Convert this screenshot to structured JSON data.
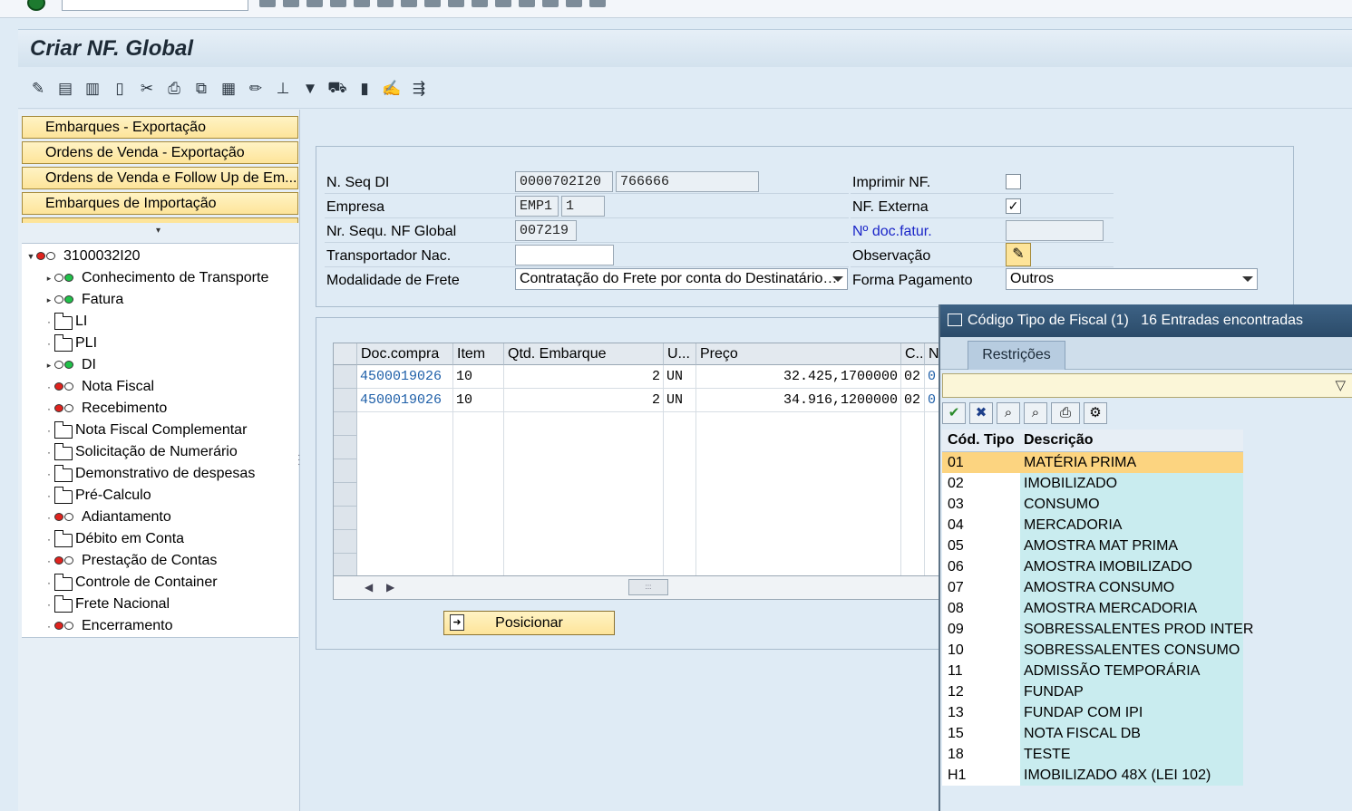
{
  "window": {
    "title": "Criar NF. Global"
  },
  "left": {
    "nav_buttons": [
      "Embarques - Exportação",
      "Ordens de Venda - Exportação",
      "Ordens de Venda e Follow Up de Em...",
      "Embarques de Importação"
    ],
    "tree": {
      "root": "3100032I20",
      "nodes": [
        {
          "label": "Conhecimento de Transporte",
          "icon": "traffic-light-green"
        },
        {
          "label": "Fatura",
          "icon": "traffic-light-green"
        },
        {
          "label": "LI",
          "icon": "folder"
        },
        {
          "label": "PLI",
          "icon": "folder"
        },
        {
          "label": "DI",
          "icon": "traffic-light-green"
        },
        {
          "label": "Nota Fiscal",
          "icon": "traffic-light-red"
        },
        {
          "label": "Recebimento",
          "icon": "traffic-light-red"
        },
        {
          "label": "Nota Fiscal Complementar",
          "icon": "folder"
        },
        {
          "label": "Solicitação de Numerário",
          "icon": "folder"
        },
        {
          "label": "Demonstrativo de despesas",
          "icon": "folder"
        },
        {
          "label": "Pré-Calculo",
          "icon": "folder"
        },
        {
          "label": "Adiantamento",
          "icon": "traffic-light-red"
        },
        {
          "label": "Débito em Conta",
          "icon": "folder"
        },
        {
          "label": "Prestação de Contas",
          "icon": "traffic-light-red"
        },
        {
          "label": "Controle de Container",
          "icon": "folder"
        },
        {
          "label": "Frete Nacional",
          "icon": "folder"
        },
        {
          "label": "Encerramento",
          "icon": "traffic-light-red"
        }
      ]
    }
  },
  "header": {
    "nseq_label": "N. Seq DI",
    "nseq_value1": "0000702I20",
    "nseq_value2": "766666",
    "empresa_label": "Empresa",
    "empresa_value1": "EMP1",
    "empresa_value2": "1",
    "nrseq_label": "Nr. Sequ. NF Global",
    "nrseq_value": "007219",
    "transp_label": "Transportador Nac.",
    "transp_value": "",
    "modal_label": "Modalidade de Frete",
    "modal_value": "Contratação do Frete por conta do Destinatário…",
    "imprimir_label": "Imprimir NF.",
    "imprimir_checked": false,
    "nfext_label": "NF. Externa",
    "nfext_checked": true,
    "nfext_mark": "✓",
    "docfatur_label": "Nº doc.fatur.",
    "docfatur_value": "",
    "obs_label": "Observação",
    "forma_label": "Forma Pagamento",
    "forma_value": "Outros"
  },
  "grid": {
    "columns": [
      "Doc.compra",
      "Item",
      "Qtd. Embarque",
      "U...",
      "Preço",
      "C..",
      "N"
    ],
    "rows": [
      {
        "doc": "4500019026",
        "item": "10",
        "qtd": "2",
        "un": "UN",
        "preco": "32.425,1700000",
        "c": "02",
        "n": "0"
      },
      {
        "doc": "4500019026",
        "item": "10",
        "qtd": "2",
        "un": "UN",
        "preco": "34.916,1200000",
        "c": "02",
        "n": "0"
      }
    ],
    "position_button": "Posicionar"
  },
  "popup": {
    "title": "Código Tipo de Fiscal (1)",
    "count_text": "16 Entradas encontradas",
    "tab": "Restrições",
    "col1": "Cód. Tipo",
    "col2": "Descrição",
    "rows": [
      {
        "code": "01",
        "desc": "MATÉRIA PRIMA"
      },
      {
        "code": "02",
        "desc": "IMOBILIZADO"
      },
      {
        "code": "03",
        "desc": "CONSUMO"
      },
      {
        "code": "04",
        "desc": "MERCADORIA"
      },
      {
        "code": "05",
        "desc": "AMOSTRA MAT PRIMA"
      },
      {
        "code": "06",
        "desc": "AMOSTRA IMOBILIZADO"
      },
      {
        "code": "07",
        "desc": "AMOSTRA CONSUMO"
      },
      {
        "code": "08",
        "desc": "AMOSTRA MERCADORIA"
      },
      {
        "code": "09",
        "desc": "SOBRESSALENTES PROD INTER"
      },
      {
        "code": "10",
        "desc": "SOBRESSALENTES  CONSUMO"
      },
      {
        "code": "11",
        "desc": "ADMISSÃO TEMPORÁRIA"
      },
      {
        "code": "12",
        "desc": "FUNDAP"
      },
      {
        "code": "13",
        "desc": "FUNDAP COM IPI"
      },
      {
        "code": "15",
        "desc": "NOTA FISCAL DB"
      },
      {
        "code": "18",
        "desc": "TESTE"
      },
      {
        "code": "H1",
        "desc": "IMOBILIZADO 48X (LEI 102)"
      }
    ]
  }
}
